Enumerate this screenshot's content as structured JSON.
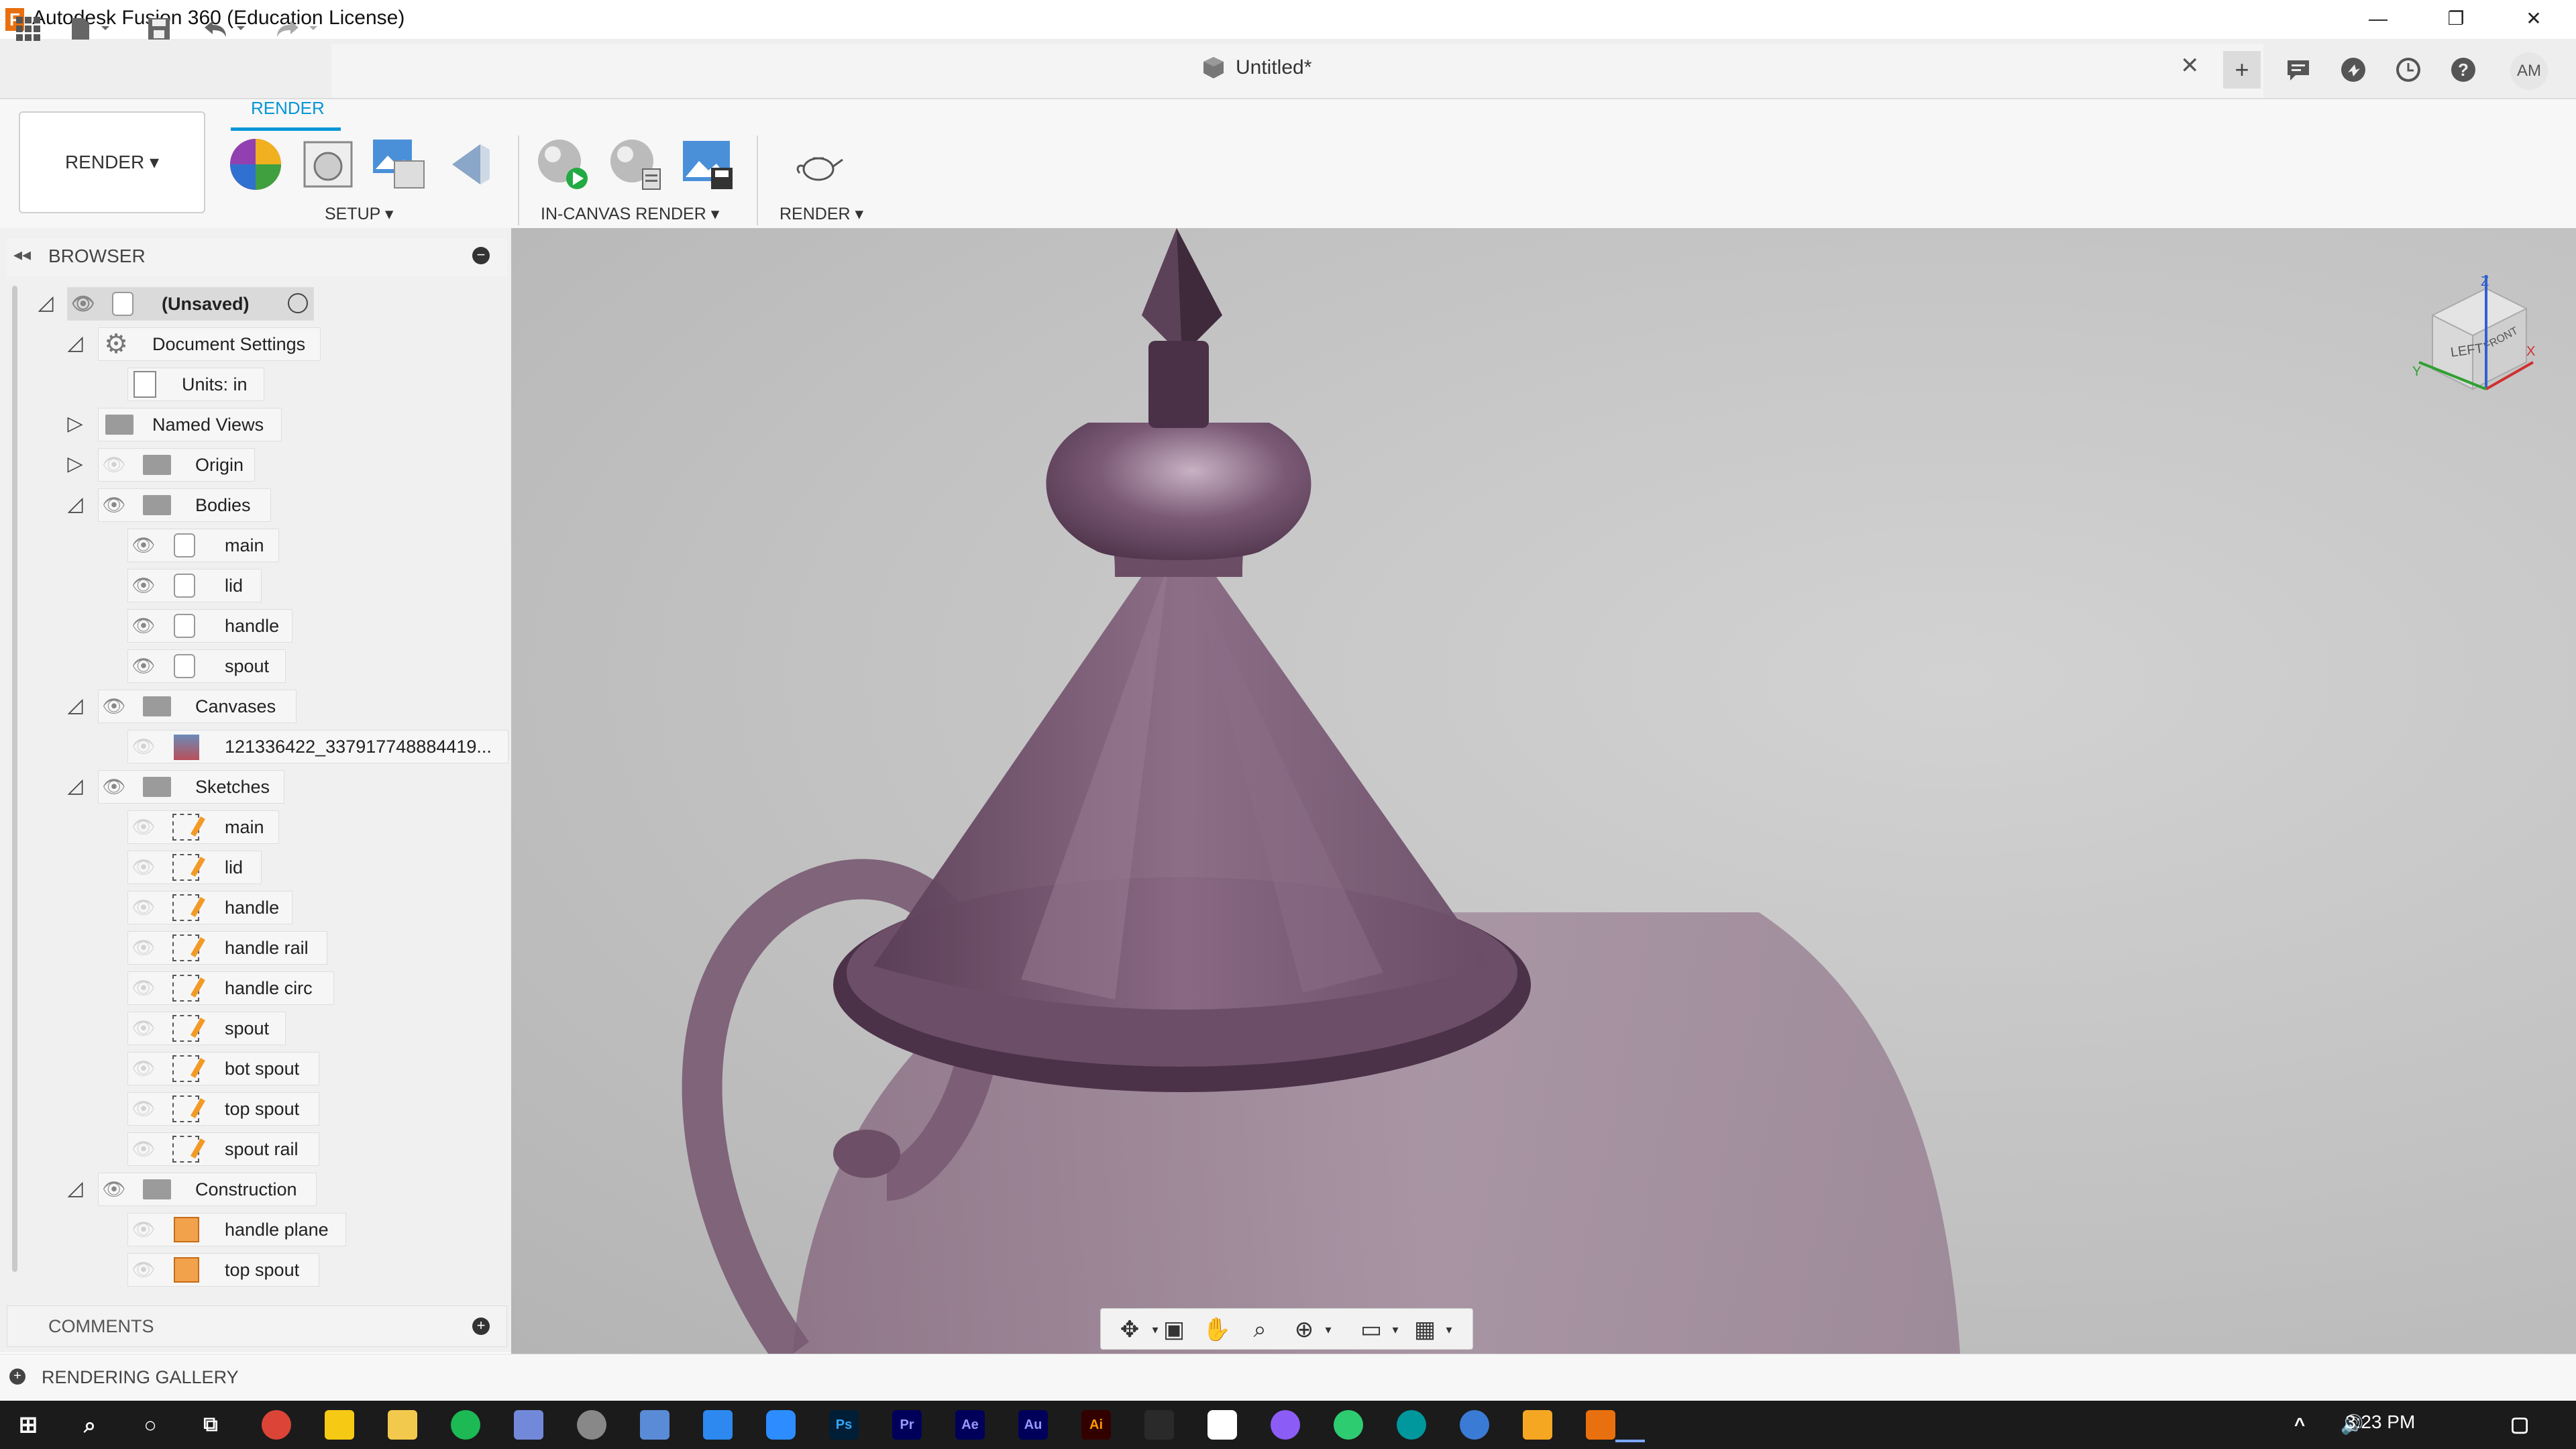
{
  "window": {
    "title": "Autodesk Fusion 360 (Education License)",
    "app_icon": "F",
    "minimize": "—",
    "restore": "❐",
    "close": "✕"
  },
  "document": {
    "title": "Untitled*",
    "close": "✕"
  },
  "user": {
    "initials": "AM"
  },
  "toolbar": {
    "workspace": "RENDER ▾",
    "active_tab": "RENDER",
    "groups": [
      {
        "label": "SETUP ▾"
      },
      {
        "label": "IN-CANVAS RENDER ▾"
      },
      {
        "label": "RENDER ▾"
      }
    ]
  },
  "browser": {
    "title": "BROWSER",
    "root": "(Unsaved)",
    "items": [
      {
        "label": "Document Settings"
      },
      {
        "label": "Units: in"
      },
      {
        "label": "Named Views"
      },
      {
        "label": "Origin"
      },
      {
        "label": "Bodies"
      },
      {
        "label": "main"
      },
      {
        "label": "lid"
      },
      {
        "label": "handle"
      },
      {
        "label": "spout"
      },
      {
        "label": "Canvases"
      },
      {
        "label": "121336422_337917748884419..."
      },
      {
        "label": "Sketches"
      },
      {
        "label": "main"
      },
      {
        "label": "lid"
      },
      {
        "label": "handle"
      },
      {
        "label": "handle rail"
      },
      {
        "label": "handle circ"
      },
      {
        "label": "spout"
      },
      {
        "label": "bot spout"
      },
      {
        "label": "top spout"
      },
      {
        "label": "spout rail"
      },
      {
        "label": "Construction"
      },
      {
        "label": "handle plane"
      },
      {
        "label": "top spout"
      }
    ]
  },
  "comments": {
    "title": "COMMENTS"
  },
  "gallery": {
    "title": "RENDERING GALLERY"
  },
  "viewcube": {
    "left": "LEFT",
    "front": "FRONT",
    "axis_z": "Z",
    "axis_x": "X",
    "axis_y": "Y"
  },
  "taskbar": {
    "apps": [
      "Ps",
      "Pr",
      "Ae",
      "Au",
      "Ai"
    ],
    "time": "3:23 PM"
  },
  "colors": {
    "accent": "#0696d7",
    "model_purple": "#6e4f67"
  }
}
